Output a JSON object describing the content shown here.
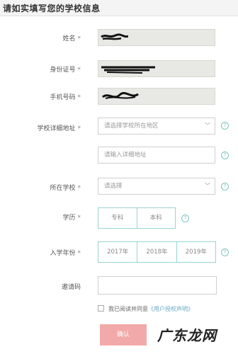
{
  "header": {
    "title": "请如实填写您的学校信息"
  },
  "form": {
    "name_label": "姓名",
    "id_label": "身份证号",
    "phone_label": "手机号码",
    "address_label": "学校详细地址",
    "address_select_placeholder": "请选择学校所在地区",
    "address_input_placeholder": "请输入详细地址",
    "school_label": "所在学校",
    "school_select_placeholder": "请选择",
    "education_label": "学历",
    "education_options": [
      "专科",
      "本科"
    ],
    "year_label": "入学年份",
    "year_options": [
      "2017年",
      "2018年",
      "2019年"
    ],
    "invite_label": "邀请码",
    "required_mark": "*",
    "help_symbol": "?"
  },
  "agree": {
    "text": "我已阅读并同意",
    "link": "《用户授权声明》"
  },
  "confirm_label": "确认",
  "watermark": {
    "text": "广东龙网"
  },
  "colors": {
    "accent": "#9ad3cf",
    "confirm": "#f2a9a9",
    "link": "#6aaac6"
  }
}
